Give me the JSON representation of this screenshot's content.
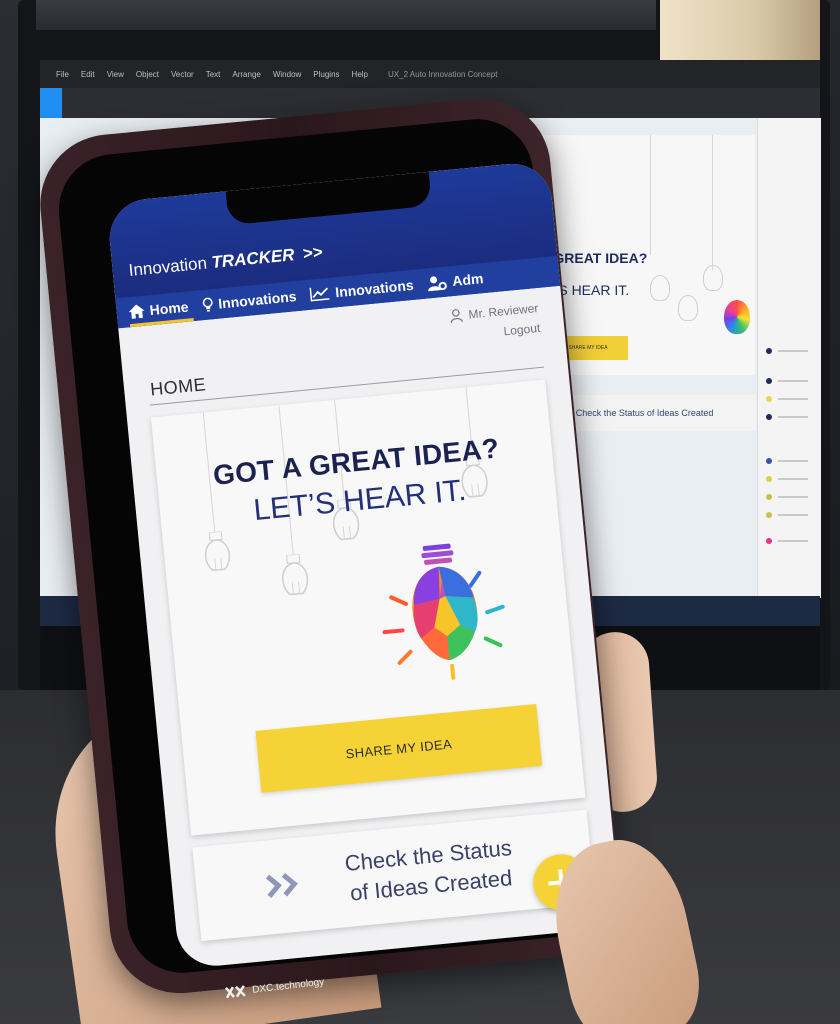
{
  "background_app": {
    "menu": [
      "File",
      "Edit",
      "View",
      "Object",
      "Vector",
      "Text",
      "Arrange",
      "Window",
      "Plugins",
      "Help"
    ],
    "filename": "UX_2 Auto Innovation Concept",
    "mockup": {
      "title_line1": "T A GREAT IDEA?",
      "title_line2": "LET'S HEAR IT.",
      "button_label": "SHARE MY IDEA",
      "status_text": "Check the Status of Ideas Created"
    }
  },
  "app": {
    "title_prefix": "Innovation",
    "title_emphasis": "TRACKER",
    "title_suffix": ">>"
  },
  "nav": {
    "items": [
      {
        "label": "Home",
        "icon": "home-icon",
        "active": true
      },
      {
        "label": "Innovations",
        "icon": "lightbulb-icon",
        "active": false
      },
      {
        "label": "Innovations",
        "icon": "line-chart-icon",
        "active": false
      },
      {
        "label": "Adm",
        "icon": "user-gear-icon",
        "active": false
      }
    ]
  },
  "user": {
    "name": "Mr. Reviewer",
    "logout_label": "Logout"
  },
  "page": {
    "title": "HOME"
  },
  "hero": {
    "headline": "GOT A GREAT IDEA?",
    "subheadline": "LET’S HEAR IT.",
    "cta_label": "SHARE MY IDEA"
  },
  "status_card": {
    "line1": "Check the Status",
    "line2": "of Ideas Created"
  },
  "fab": {
    "icon": "plus-icon"
  },
  "brand": {
    "name": "DXC.technology"
  },
  "colors": {
    "header_blue": "#1d3a9a",
    "accent_yellow": "#f5d336",
    "headline_navy": "#1c2250",
    "active_underline": "#f4c428"
  }
}
